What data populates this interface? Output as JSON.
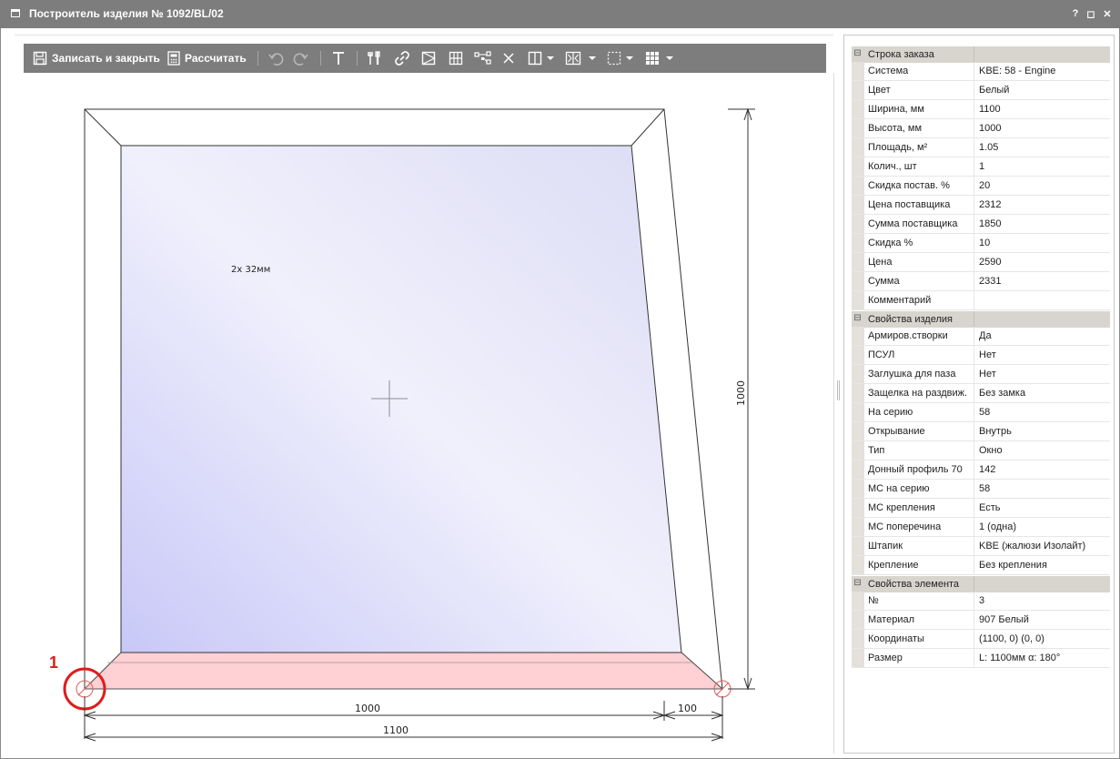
{
  "window": {
    "title": "Построитель изделия № 1092/BL/02",
    "help": "?",
    "maximize": "◻",
    "close": "✕"
  },
  "toolbar": {
    "save_close": "Записать и закрыть",
    "calculate": "Рассчитать",
    "icons": [
      "save-icon",
      "calculator-icon",
      "undo-icon",
      "redo-icon",
      "text-icon",
      "tools-icon",
      "link-icon",
      "glass-icon",
      "grid-icon",
      "nodes-icon",
      "delete-icon",
      "split-icon",
      "arrow-icon",
      "sash-icon",
      "arrow-icon",
      "select-icon",
      "arrow-icon",
      "layout-icon",
      "arrow-icon"
    ]
  },
  "drawing": {
    "glass_label": "2x 32мм",
    "dim_height": "1000",
    "dim_width_a": "1000",
    "dim_width_b": "100",
    "dim_total": "1100",
    "marker_label": "1",
    "colors": {
      "glass": "#dcdcf5",
      "selected": "#ffd0d4",
      "marker": "#e01b1b"
    }
  },
  "properties": {
    "order": {
      "title": "Строка заказа",
      "rows": [
        {
          "name": "Система",
          "value": "KBE: 58 - Engine"
        },
        {
          "name": "Цвет",
          "value": "Белый"
        },
        {
          "name": "Ширина, мм",
          "value": "1100"
        },
        {
          "name": "Высота, мм",
          "value": "1000"
        },
        {
          "name": "Площадь, м²",
          "value": "1.05"
        },
        {
          "name": "Колич., шт",
          "value": "1"
        },
        {
          "name": "Скидка постав. %",
          "value": "20"
        },
        {
          "name": "Цена поставщика",
          "value": "2312"
        },
        {
          "name": "Сумма поставщика",
          "value": "1850"
        },
        {
          "name": "Скидка %",
          "value": "10"
        },
        {
          "name": "Цена",
          "value": "2590"
        },
        {
          "name": "Сумма",
          "value": "2331"
        },
        {
          "name": "Комментарий",
          "value": ""
        }
      ]
    },
    "product": {
      "title": "Свойства изделия",
      "rows": [
        {
          "name": "Армиров.створки",
          "value": "Да"
        },
        {
          "name": "ПСУЛ",
          "value": "Нет"
        },
        {
          "name": "Заглушка для паза",
          "value": "Нет"
        },
        {
          "name": "Защелка на раздвиж.",
          "value": "Без замка"
        },
        {
          "name": "На серию",
          "value": "58"
        },
        {
          "name": "Открывание",
          "value": "Внутрь"
        },
        {
          "name": "Тип",
          "value": "Окно"
        },
        {
          "name": "Донный профиль 70",
          "value": "142"
        },
        {
          "name": "МС на серию",
          "value": "58"
        },
        {
          "name": "МС крепления",
          "value": "Есть"
        },
        {
          "name": "МС поперечина",
          "value": "1 (одна)"
        },
        {
          "name": "Штапик",
          "value": "KBE (жалюзи Изолайт)"
        },
        {
          "name": "Крепление",
          "value": "Без крепления"
        }
      ]
    },
    "element": {
      "title": "Свойства элемента",
      "rows": [
        {
          "name": "№",
          "value": "3"
        },
        {
          "name": "Материал",
          "value": "907 Белый"
        },
        {
          "name": "Координаты",
          "value": "(1100, 0) (0, 0)"
        },
        {
          "name": "Размер",
          "value": "L: 1100мм  α: 180°"
        }
      ]
    }
  }
}
